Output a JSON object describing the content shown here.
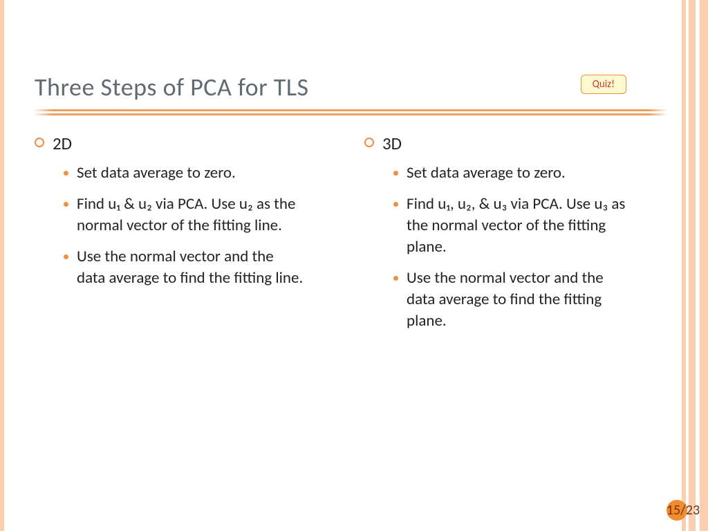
{
  "title": "Three Steps of PCA for TLS",
  "quiz_label": "Quiz!",
  "columns": {
    "left": {
      "heading": "2D",
      "items": [
        "Set data average to zero.",
        "Find u₁ & u₂ via PCA. Use u₂ as the normal vector of the fitting line.",
        "Use the normal vector and the data average to find the fitting line."
      ]
    },
    "right": {
      "heading": "3D",
      "items": [
        "Set data average to zero.",
        "Find u₁, u₂, & u₃ via PCA. Use u₃ as the normal vector of the fitting plane.",
        "Use the normal vector and the data average to find the fitting plane."
      ]
    }
  },
  "page": {
    "current": "15",
    "sep": "/",
    "total": "23"
  }
}
